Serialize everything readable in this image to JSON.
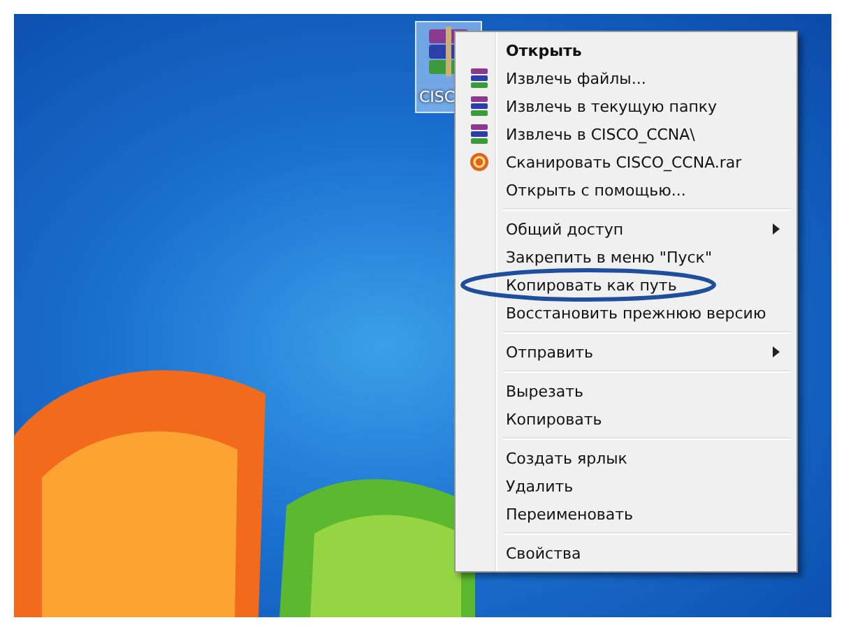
{
  "desktop": {
    "icon": {
      "label": "CISC",
      "selected": true
    }
  },
  "context_menu": {
    "items": [
      {
        "kind": "plain",
        "label": "Открыть",
        "default": true,
        "submenu": false,
        "circled": false
      },
      {
        "kind": "archive",
        "label": "Извлечь файлы...",
        "default": false,
        "submenu": false,
        "circled": false
      },
      {
        "kind": "archive",
        "label": "Извлечь в текущую папку",
        "default": false,
        "submenu": false,
        "circled": false
      },
      {
        "kind": "archive",
        "label": "Извлечь в CISCO_CCNA\\",
        "default": false,
        "submenu": false,
        "circled": false
      },
      {
        "kind": "scan",
        "label": "Сканировать CISCO_CCNA.rar",
        "default": false,
        "submenu": false,
        "circled": false
      },
      {
        "kind": "plain",
        "label": "Открыть с помощью...",
        "default": false,
        "submenu": false,
        "circled": false
      },
      {
        "kind": "separator"
      },
      {
        "kind": "plain",
        "label": "Общий доступ",
        "default": false,
        "submenu": true,
        "circled": false
      },
      {
        "kind": "plain",
        "label": "Закрепить в меню \"Пуск\"",
        "default": false,
        "submenu": false,
        "circled": false
      },
      {
        "kind": "plain",
        "label": "Копировать как путь",
        "default": false,
        "submenu": false,
        "circled": true
      },
      {
        "kind": "plain",
        "label": "Восстановить прежнюю версию",
        "default": false,
        "submenu": false,
        "circled": false
      },
      {
        "kind": "separator"
      },
      {
        "kind": "plain",
        "label": "Отправить",
        "default": false,
        "submenu": true,
        "circled": false
      },
      {
        "kind": "separator"
      },
      {
        "kind": "plain",
        "label": "Вырезать",
        "default": false,
        "submenu": false,
        "circled": false
      },
      {
        "kind": "plain",
        "label": "Копировать",
        "default": false,
        "submenu": false,
        "circled": false
      },
      {
        "kind": "separator"
      },
      {
        "kind": "plain",
        "label": "Создать ярлык",
        "default": false,
        "submenu": false,
        "circled": false
      },
      {
        "kind": "plain",
        "label": "Удалить",
        "default": false,
        "submenu": false,
        "circled": false
      },
      {
        "kind": "plain",
        "label": "Переименовать",
        "default": false,
        "submenu": false,
        "circled": false
      },
      {
        "kind": "separator"
      },
      {
        "kind": "plain",
        "label": "Свойства",
        "default": false,
        "submenu": false,
        "circled": false
      }
    ]
  }
}
